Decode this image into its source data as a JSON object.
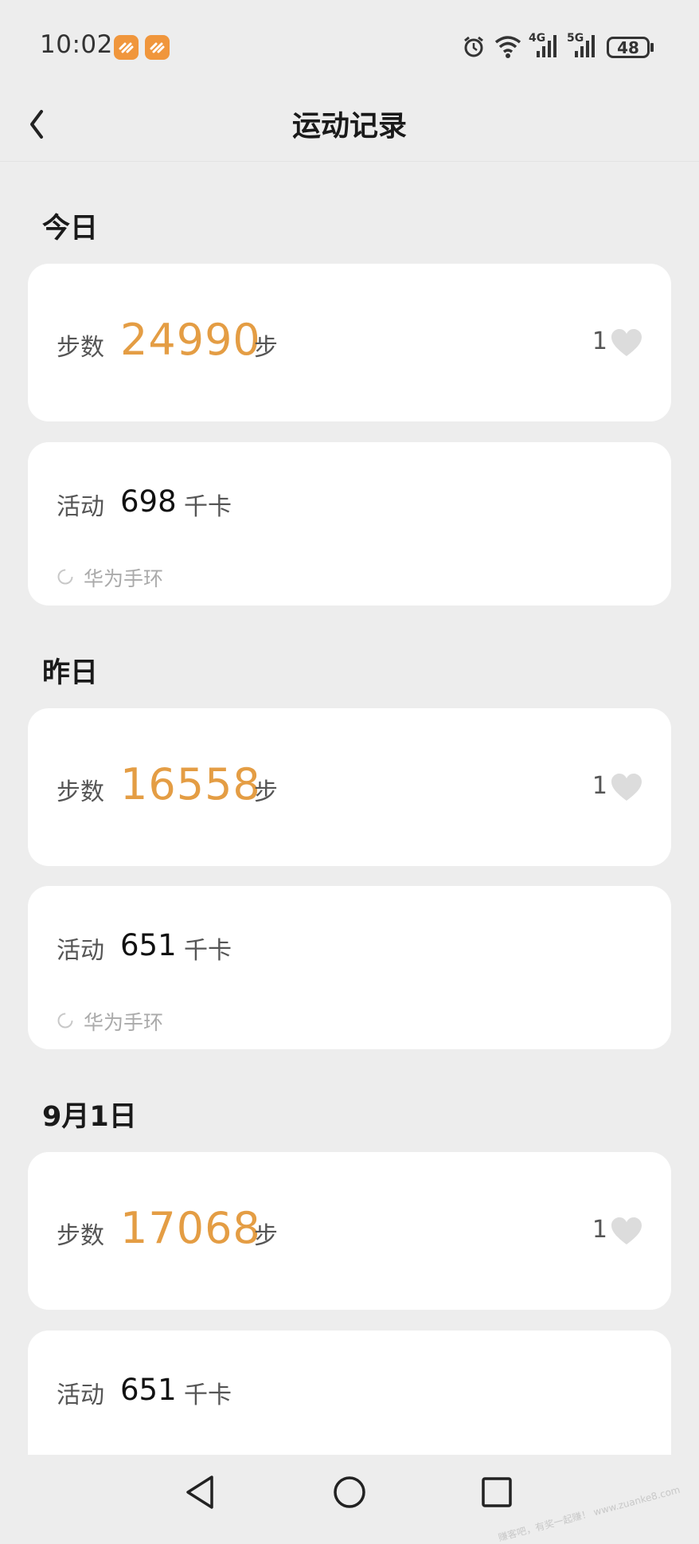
{
  "status_bar": {
    "time": "10:02",
    "network_4g": "4G",
    "network_5g": "5G",
    "battery": "48"
  },
  "header": {
    "title": "运动记录",
    "back_icon": "chevron-left-icon"
  },
  "days": [
    {
      "label": "今日",
      "steps_label": "步数",
      "steps_value": "24990",
      "steps_unit": "步",
      "likes": "1",
      "activity_label": "活动",
      "activity_value": "698",
      "activity_unit": "千卡",
      "device": "华为手环"
    },
    {
      "label": "昨日",
      "steps_label": "步数",
      "steps_value": "16558",
      "steps_unit": "步",
      "likes": "1",
      "activity_label": "活动",
      "activity_value": "651",
      "activity_unit": "千卡",
      "device": "华为手环"
    },
    {
      "label": "9月1日",
      "steps_label": "步数",
      "steps_value": "17068",
      "steps_unit": "步",
      "likes": "1",
      "activity_label": "活动",
      "activity_value": "651",
      "activity_unit": "千卡"
    }
  ],
  "watermark": "赚客吧，有奖一起赚！ www.zuanke8.com",
  "colors": {
    "accent": "#e49d44",
    "background": "#ededed",
    "card": "#ffffff",
    "app_badge": "#f0963c"
  }
}
